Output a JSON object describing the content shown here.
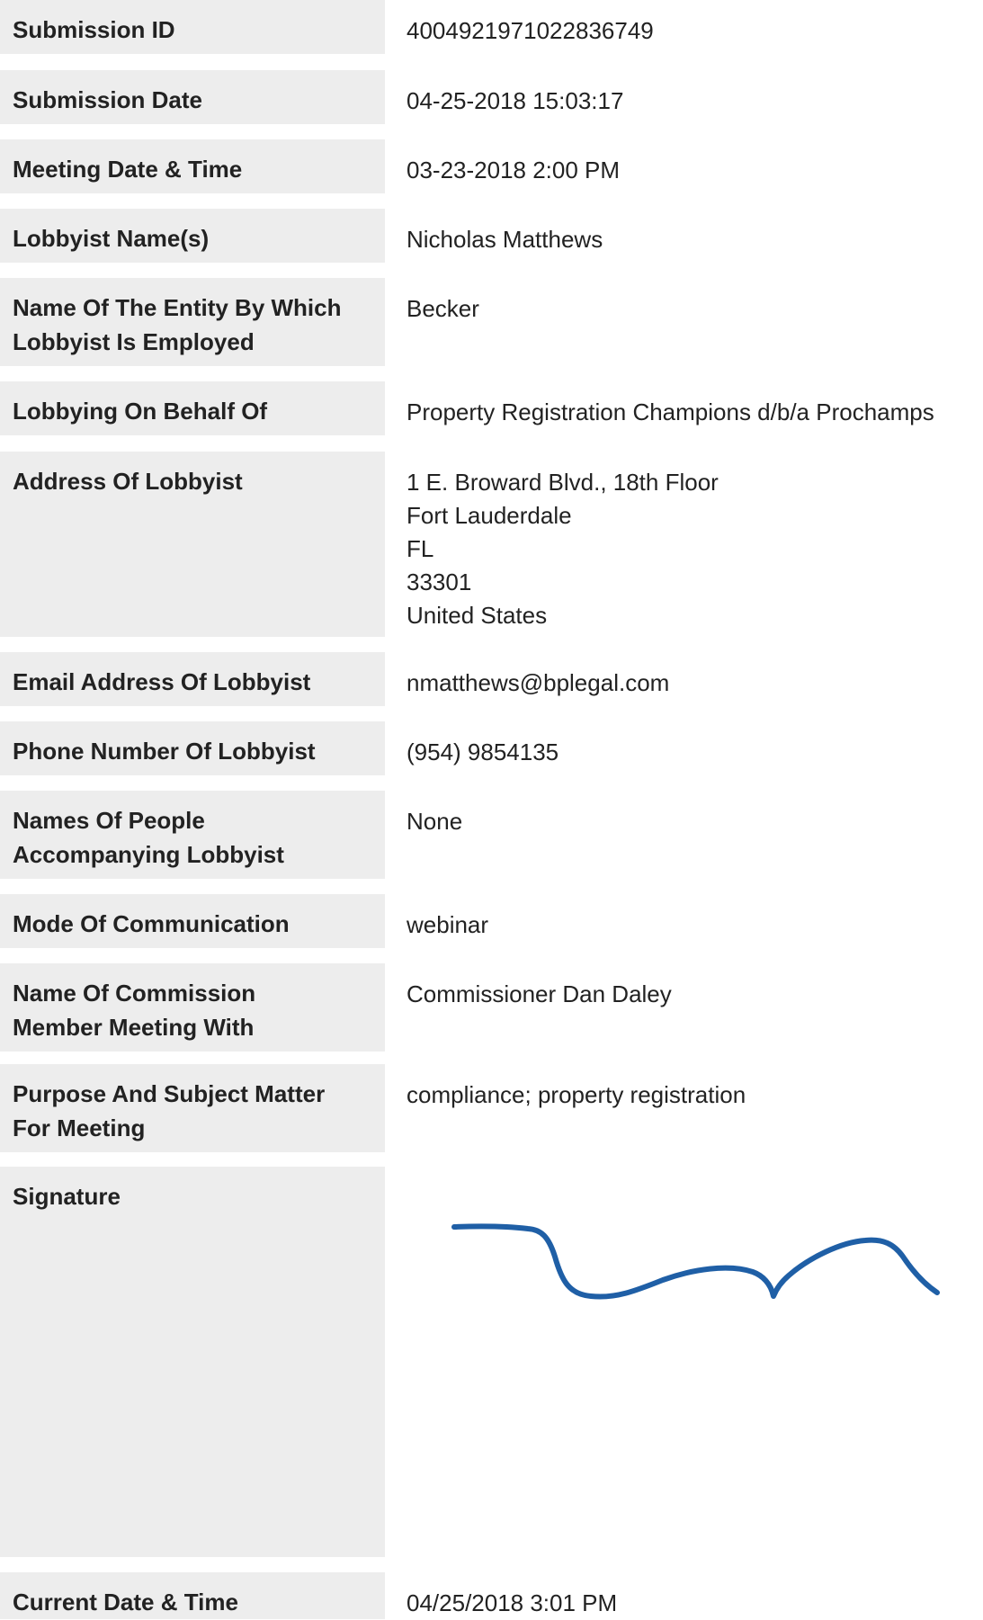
{
  "fields": {
    "submission_id": {
      "label": "Submission ID",
      "value": "4004921971022836749"
    },
    "submission_date": {
      "label": "Submission Date",
      "value": "04-25-2018 15:03:17"
    },
    "meeting_date_time": {
      "label": "Meeting Date & Time",
      "value": "03-23-2018 2:00 PM"
    },
    "lobbyist_names": {
      "label": "Lobbyist Name(s)",
      "value": "Nicholas Matthews"
    },
    "entity_name": {
      "label_line1": "Name Of The Entity By Which",
      "label_line2": "Lobbyist Is Employed",
      "value": "Becker"
    },
    "behalf_of": {
      "label": "Lobbying On Behalf Of",
      "value": "Property Registration Champions d/b/a Prochamps"
    },
    "address": {
      "label": "Address Of Lobbyist",
      "street": "1 E. Broward Blvd., 18th Floor",
      "city": "Fort Lauderdale",
      "state": "FL",
      "zip": "33301",
      "country": "United States"
    },
    "email": {
      "label": "Email Address Of Lobbyist",
      "value": "nmatthews@bplegal.com"
    },
    "phone": {
      "label": "Phone Number Of Lobbyist",
      "value": "(954) 9854135"
    },
    "accompanying": {
      "label_line1": "Names Of People",
      "label_line2": "Accompanying Lobbyist",
      "value": "None"
    },
    "mode": {
      "label": "Mode Of Communication",
      "value": "webinar"
    },
    "commission_member": {
      "label_line1": "Name Of Commission",
      "label_line2": "Member Meeting With",
      "value": "Commissioner Dan Daley"
    },
    "purpose": {
      "label_line1": "Purpose And Subject Matter",
      "label_line2": "For Meeting",
      "value": "compliance; property registration"
    },
    "signature": {
      "label": "Signature",
      "stroke_color": "#1f5fa6"
    },
    "current_date_time": {
      "label": "Current Date & Time",
      "value": "04/25/2018 3:01 PM"
    }
  }
}
